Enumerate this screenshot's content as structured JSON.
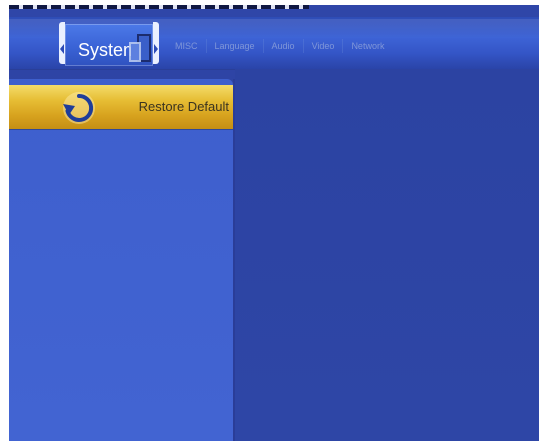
{
  "header": {
    "active_section": "System",
    "tabs": [
      "MISC",
      "Language",
      "Audio",
      "Video",
      "Network"
    ]
  },
  "menu": {
    "items": [
      {
        "label": "Restore Default",
        "icon": "restore-icon",
        "selected": true
      }
    ]
  },
  "colors": {
    "background": "#2c41a0",
    "highlight": "#e6bd34",
    "panel": "#4264d2",
    "tab_text": "#7f96d8"
  }
}
